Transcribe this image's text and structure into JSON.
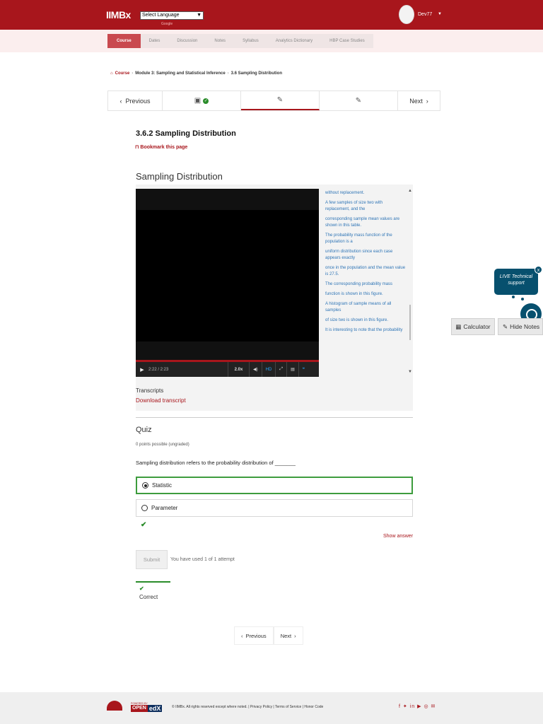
{
  "header": {
    "logo": "IIMBx",
    "language_select": "Select Language",
    "google_tag": "Google",
    "username": "Dev77"
  },
  "course_nav": {
    "tabs": [
      "Course",
      "Dates",
      "Discussion",
      "Notes",
      "Syllabus",
      "Analytics Dictionary",
      "HBP Case Studies"
    ],
    "active_tab": "Course"
  },
  "breadcrumb": {
    "course": "Course",
    "module": "Module 3: Sampling and Statistical Inference",
    "section": "3.6 Sampling Distribution",
    "separator": "›"
  },
  "sequence_nav": {
    "previous": "Previous",
    "next": "Next"
  },
  "unit": {
    "title": "3.6.2 Sampling Distribution",
    "bookmark": "Bookmark this page",
    "section_title": "Sampling Distribution"
  },
  "video": {
    "time": "2:22 / 2:23",
    "speed": "2.0x",
    "hd": "HD",
    "progress": 0.99,
    "transcript_lines": [
      "without replacement.",
      "A few samples of size two with replacement, and the",
      "corresponding sample mean values are shown in this table.",
      "The probability mass function of the population is a",
      "uniform distribution since each case appears exactly",
      "once in the population and the mean value is 27.5.",
      "The corresponding probability mass",
      "function is shown in this figure.",
      "A histogram of sample means of all samples",
      "of size two is shown in this figure.",
      "It is interesting to note that the probability"
    ],
    "transcripts_label": "Transcripts",
    "download_transcript": "Download transcript"
  },
  "quiz": {
    "title": "Quiz",
    "points": "0 points possible (ungraded)",
    "question": "Sampling distribution refers to the probability distribution of _______",
    "options": [
      {
        "label": "Statistic",
        "selected": true
      },
      {
        "label": "Parameter",
        "selected": false
      }
    ],
    "show_answer": "Show answer",
    "submit": "Submit",
    "attempts": "You have used 1 of 1 attempt",
    "status": "Correct"
  },
  "bottom_nav": {
    "previous": "Previous",
    "next": "Next"
  },
  "widgets": {
    "live_support": "LIVE Technical support",
    "close": "x",
    "calculator": "Calculator",
    "hide_notes": "Hide Notes"
  },
  "footer": {
    "powered_by": "POWERED BY",
    "open": "OPEN",
    "edx": "edX",
    "copyright": "© IIMBx. All rights reserved except where noted.",
    "links": [
      "Privacy Policy",
      "Terms of Service",
      "Honor Code"
    ],
    "social_icons": [
      "facebook-icon",
      "twitter-icon",
      "linkedin-icon",
      "youtube-icon",
      "instagram-icon",
      "email-icon"
    ]
  },
  "colors": {
    "brand": "#a8161c",
    "link_blue": "#2f75b6",
    "success": "#2a8c2a",
    "support": "#07506e"
  }
}
